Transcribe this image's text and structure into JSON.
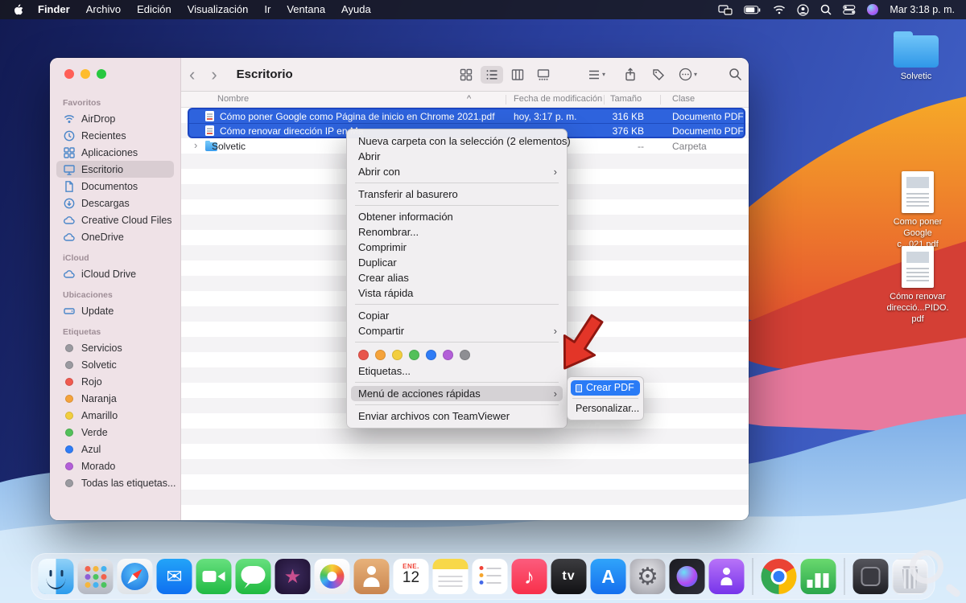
{
  "menu_bar": {
    "menus": [
      "Finder",
      "Archivo",
      "Edición",
      "Visualización",
      "Ir",
      "Ventana",
      "Ayuda"
    ],
    "clock": "Mar 3:18 p. m.",
    "status_icons": [
      "display-icon",
      "battery-icon",
      "wifi-icon",
      "user-icon",
      "spotlight-icon",
      "control-center-icon",
      "siri-icon"
    ]
  },
  "ui": {
    "back": "‹",
    "forward": "›",
    "chevron_right": "›",
    "caret_down": "▾",
    "disclosure": "›"
  },
  "window": {
    "toolbar": {
      "title": "Escritorio"
    },
    "sidebar": {
      "sections": [
        {
          "title": "Favoritos",
          "items": [
            {
              "label": "AirDrop",
              "icon": "airdrop-icon"
            },
            {
              "label": "Recientes",
              "icon": "clock-icon"
            },
            {
              "label": "Aplicaciones",
              "icon": "applications-icon"
            },
            {
              "label": "Escritorio",
              "icon": "desktop-icon",
              "selected": true
            },
            {
              "label": "Documentos",
              "icon": "document-icon"
            },
            {
              "label": "Descargas",
              "icon": "downloads-icon"
            },
            {
              "label": "Creative Cloud Files",
              "icon": "cloud-icon"
            },
            {
              "label": "OneDrive",
              "icon": "cloud-icon"
            }
          ]
        },
        {
          "title": "iCloud",
          "items": [
            {
              "label": "iCloud Drive",
              "icon": "cloud-icon"
            }
          ]
        },
        {
          "title": "Ubicaciones",
          "items": [
            {
              "label": "Update",
              "icon": "disk-icon"
            }
          ]
        },
        {
          "title": "Etiquetas",
          "items": [
            {
              "label": "Servicios",
              "dot": "#9a9aa0"
            },
            {
              "label": "Solvetic",
              "dot": "#9a9aa0"
            },
            {
              "label": "Rojo",
              "dot": "#f05a4f"
            },
            {
              "label": "Naranja",
              "dot": "#f5a33b"
            },
            {
              "label": "Amarillo",
              "dot": "#f2ce3e"
            },
            {
              "label": "Verde",
              "dot": "#53c05a"
            },
            {
              "label": "Azul",
              "dot": "#2f7cf6"
            },
            {
              "label": "Morado",
              "dot": "#b35fd8"
            },
            {
              "label": "Todas las etiquetas...",
              "dot": "#9a9aa0"
            }
          ]
        }
      ]
    },
    "columns": {
      "name": "Nombre",
      "date": "Fecha de modificación",
      "size": "Tamaño",
      "kind": "Clase",
      "sort_indicator": "^"
    },
    "rows": [
      {
        "name": "Cómo poner Google como Página de inicio en Chrome 2021.pdf",
        "date": "hoy, 3:17 p. m.",
        "size": "316 KB",
        "kind": "Documento PDF"
      },
      {
        "name": "Cómo renovar dirección IP en Ma",
        "date": "",
        "size": "376 KB",
        "kind": "Documento PDF"
      },
      {
        "name": "Solvetic",
        "date": "",
        "size": "--",
        "kind": "Carpeta"
      }
    ]
  },
  "context_menu": {
    "new_folder_with_selection": "Nueva carpeta con la selección (2 elementos)",
    "open": "Abrir",
    "open_with": "Abrir con",
    "move_to_trash": "Transferir al basurero",
    "get_info": "Obtener información",
    "rename": "Renombrar...",
    "compress": "Comprimir",
    "duplicate": "Duplicar",
    "make_alias": "Crear alias",
    "quick_look": "Vista rápida",
    "copy": "Copiar",
    "share": "Compartir",
    "tags": "Etiquetas...",
    "quick_actions": "Menú de acciones rápidas",
    "teamviewer": "Enviar archivos con TeamViewer",
    "tag_colors": [
      "#e8554c",
      "#f5a33b",
      "#f2ce3e",
      "#53c05a",
      "#2f7cf6",
      "#b35fd8",
      "#8e8e93"
    ]
  },
  "submenu": {
    "create_pdf": "Crear PDF",
    "customize": "Personalizar..."
  },
  "desktop": {
    "icons": [
      {
        "label": "Solvetic",
        "type": "folder-icon"
      },
      {
        "label": "Como poner Google c...021.pdf",
        "type": "pdf-icon"
      },
      {
        "label": "Cómo renovar direcció...PIDO.pdf",
        "type": "pdf-icon"
      }
    ]
  },
  "dock": {
    "calendar_month": "ENE.",
    "calendar_day": "12",
    "apps": [
      "finder",
      "launchpad",
      "safari",
      "mail",
      "facetime",
      "messages",
      "imovie",
      "photos",
      "contacts",
      "calendar",
      "notes",
      "reminders",
      "music",
      "appletv",
      "appstore",
      "system-preferences",
      "siri",
      "podcasts",
      "chrome",
      "numbers",
      "screenshot",
      "trash"
    ]
  },
  "colors": {
    "selection_blue": "#2e63dd",
    "selection_border": "#1b46c2",
    "submenu_highlight": "#2a7bf6",
    "menu_highlight": "#d5d2d5",
    "arrow_red": "#e33528",
    "sidebar_bg": "#efe2e7"
  }
}
